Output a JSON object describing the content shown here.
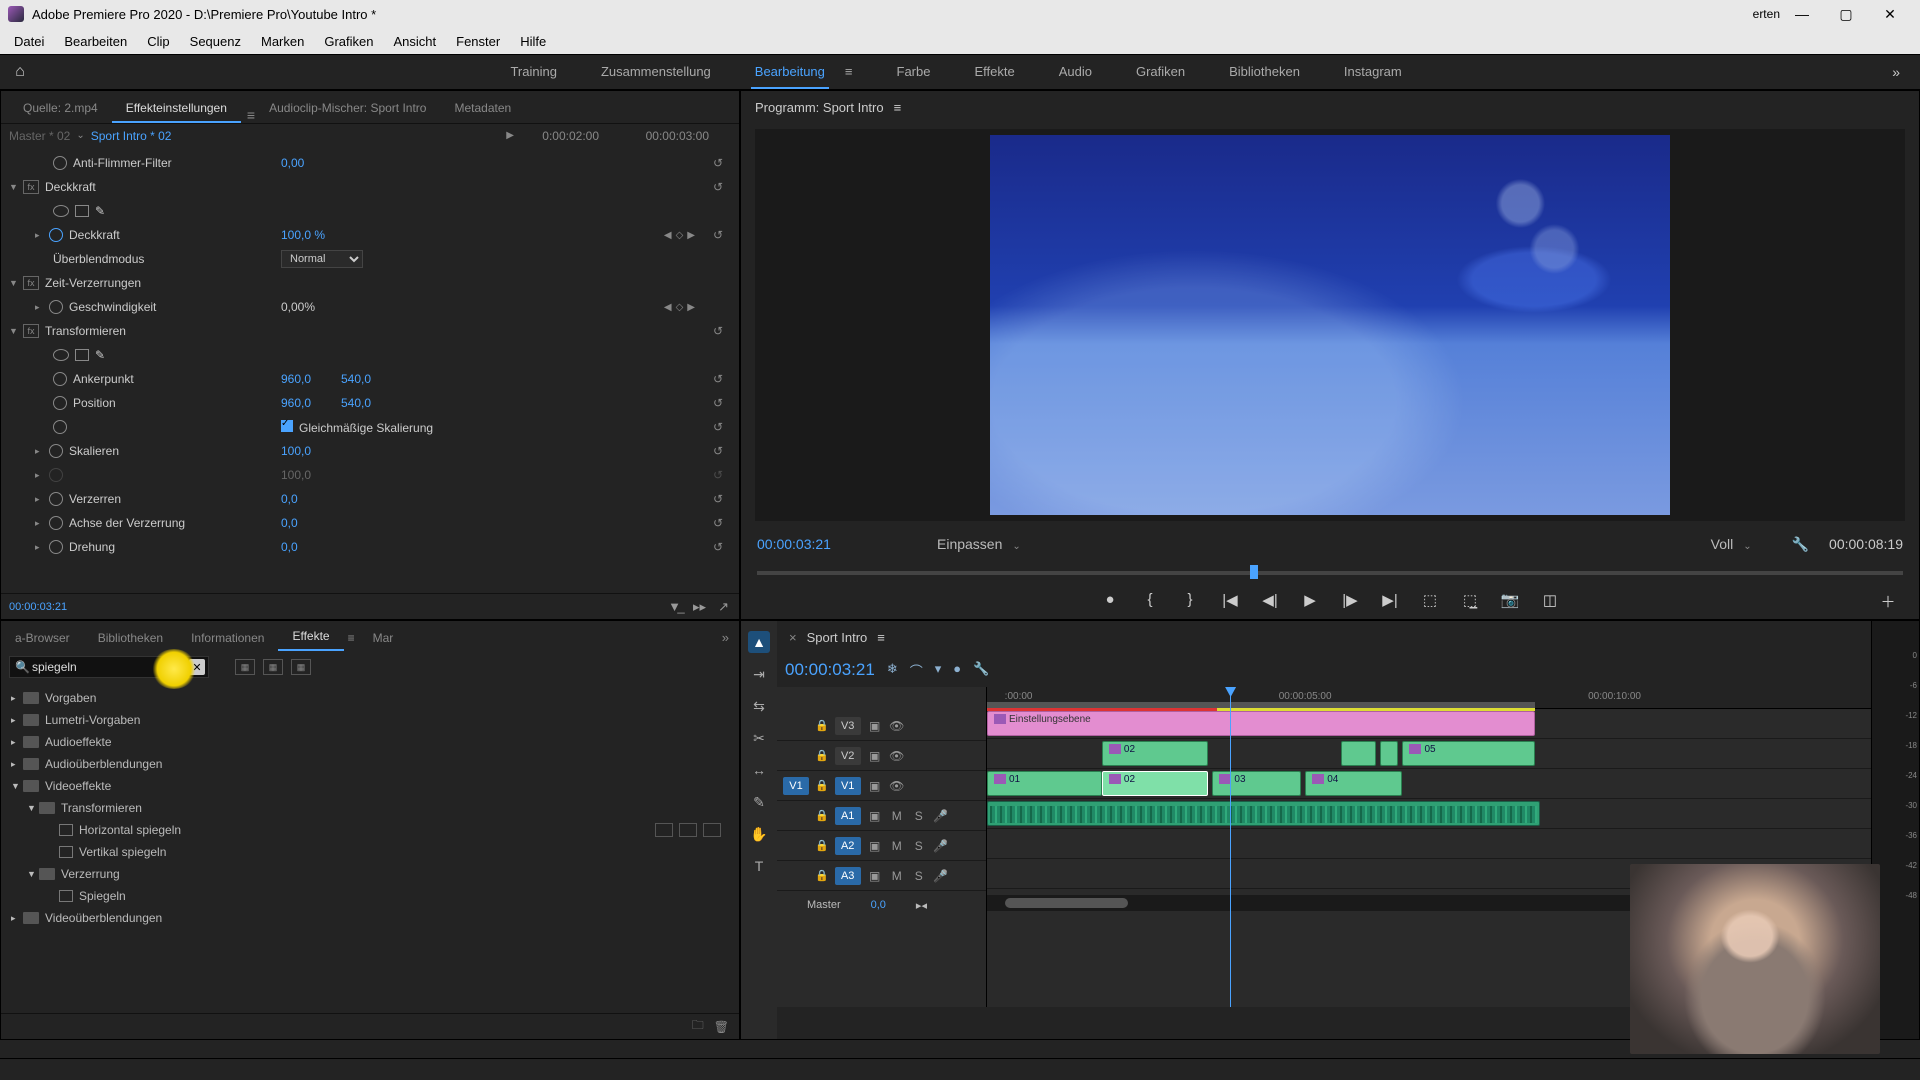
{
  "titlebar": {
    "title": "Adobe Premiere Pro 2020 - D:\\Premiere Pro\\Youtube Intro *"
  },
  "menu": [
    "Datei",
    "Bearbeiten",
    "Clip",
    "Sequenz",
    "Marken",
    "Grafiken",
    "Ansicht",
    "Fenster",
    "Hilfe"
  ],
  "workspaces": {
    "items": [
      "Training",
      "Zusammenstellung",
      "Bearbeitung",
      "Farbe",
      "Effekte",
      "Audio",
      "Grafiken",
      "Bibliotheken",
      "Instagram"
    ],
    "active": "Bearbeitung"
  },
  "source_tabs": {
    "items": [
      "Quelle: 2.mp4",
      "Effekteinstellungen",
      "Audioclip-Mischer: Sport Intro",
      "Metadaten"
    ],
    "active": 1
  },
  "effect_controls": {
    "crumb_master": "Master * 02",
    "crumb_clip": "Sport Intro * 02",
    "time_left": "0:00:02:00",
    "time_right": "00:00:03:00",
    "rows": {
      "anti_flicker": {
        "label": "Anti-Flimmer-Filter",
        "val": "0,00"
      },
      "deckkraft_head": "Deckkraft",
      "deckkraft": {
        "label": "Deckkraft",
        "val": "100,0 %"
      },
      "blendmode": {
        "label": "Überblendmodus",
        "val": "Normal"
      },
      "zeit_head": "Zeit-Verzerrungen",
      "speed": {
        "label": "Geschwindigkeit",
        "val": "0,00%"
      },
      "transform_head": "Transformieren",
      "anchor": {
        "label": "Ankerpunkt",
        "v1": "960,0",
        "v2": "540,0"
      },
      "position": {
        "label": "Position",
        "v1": "960,0",
        "v2": "540,0"
      },
      "uniform": "Gleichmäßige Skalierung",
      "scale": {
        "label": "Skalieren",
        "val": "100,0"
      },
      "scale2": {
        "val": "100,0"
      },
      "distort": {
        "label": "Verzerren",
        "val": "0,0"
      },
      "distort_axis": {
        "label": "Achse der Verzerrung",
        "val": "0,0"
      },
      "rotation": {
        "label": "Drehung",
        "val": "0,0"
      }
    },
    "footer_time": "00:00:03:21"
  },
  "program": {
    "title": "Programm: Sport Intro",
    "tc_left": "00:00:03:21",
    "fit": "Einpassen",
    "full": "Voll",
    "tc_right": "00:00:08:19"
  },
  "effects_tabs": {
    "items": [
      "a-Browser",
      "Bibliotheken",
      "Informationen",
      "Effekte",
      "Mar"
    ],
    "active": 3
  },
  "effects_panel": {
    "search": "spiegeln",
    "tree": [
      {
        "label": "Vorgaben",
        "level": 0,
        "type": "folder"
      },
      {
        "label": "Lumetri-Vorgaben",
        "level": 0,
        "type": "folder"
      },
      {
        "label": "Audioeffekte",
        "level": 0,
        "type": "folder"
      },
      {
        "label": "Audioüberblendungen",
        "level": 0,
        "type": "folder"
      },
      {
        "label": "Videoeffekte",
        "level": 0,
        "type": "folder",
        "open": true
      },
      {
        "label": "Transformieren",
        "level": 1,
        "type": "folder",
        "open": true
      },
      {
        "label": "Horizontal spiegeln",
        "level": 2,
        "type": "effect",
        "badges": true
      },
      {
        "label": "Vertikal spiegeln",
        "level": 2,
        "type": "effect"
      },
      {
        "label": "Verzerrung",
        "level": 1,
        "type": "folder",
        "open": true
      },
      {
        "label": "Spiegeln",
        "level": 2,
        "type": "effect"
      },
      {
        "label": "Videoüberblendungen",
        "level": 0,
        "type": "folder"
      }
    ]
  },
  "timeline": {
    "title": "Sport Intro",
    "tc": "00:00:03:21",
    "ruler": [
      ":00:00",
      "00:00:05:00",
      "00:00:10:00"
    ],
    "tracks": {
      "v3": "V3",
      "v2": "V2",
      "v1": "V1",
      "a1": "A1",
      "a2": "A2",
      "a3": "A3",
      "master": "Master",
      "master_val": "0,0"
    },
    "clips": {
      "adj": "Einstellungsebene",
      "c01": "01",
      "c02": "02",
      "c03": "03",
      "c04": "04",
      "c05": "05"
    }
  },
  "meters": [
    "0",
    "-6",
    "-12",
    "-18",
    "-24",
    "-30",
    "-36",
    "-42",
    "-48"
  ]
}
